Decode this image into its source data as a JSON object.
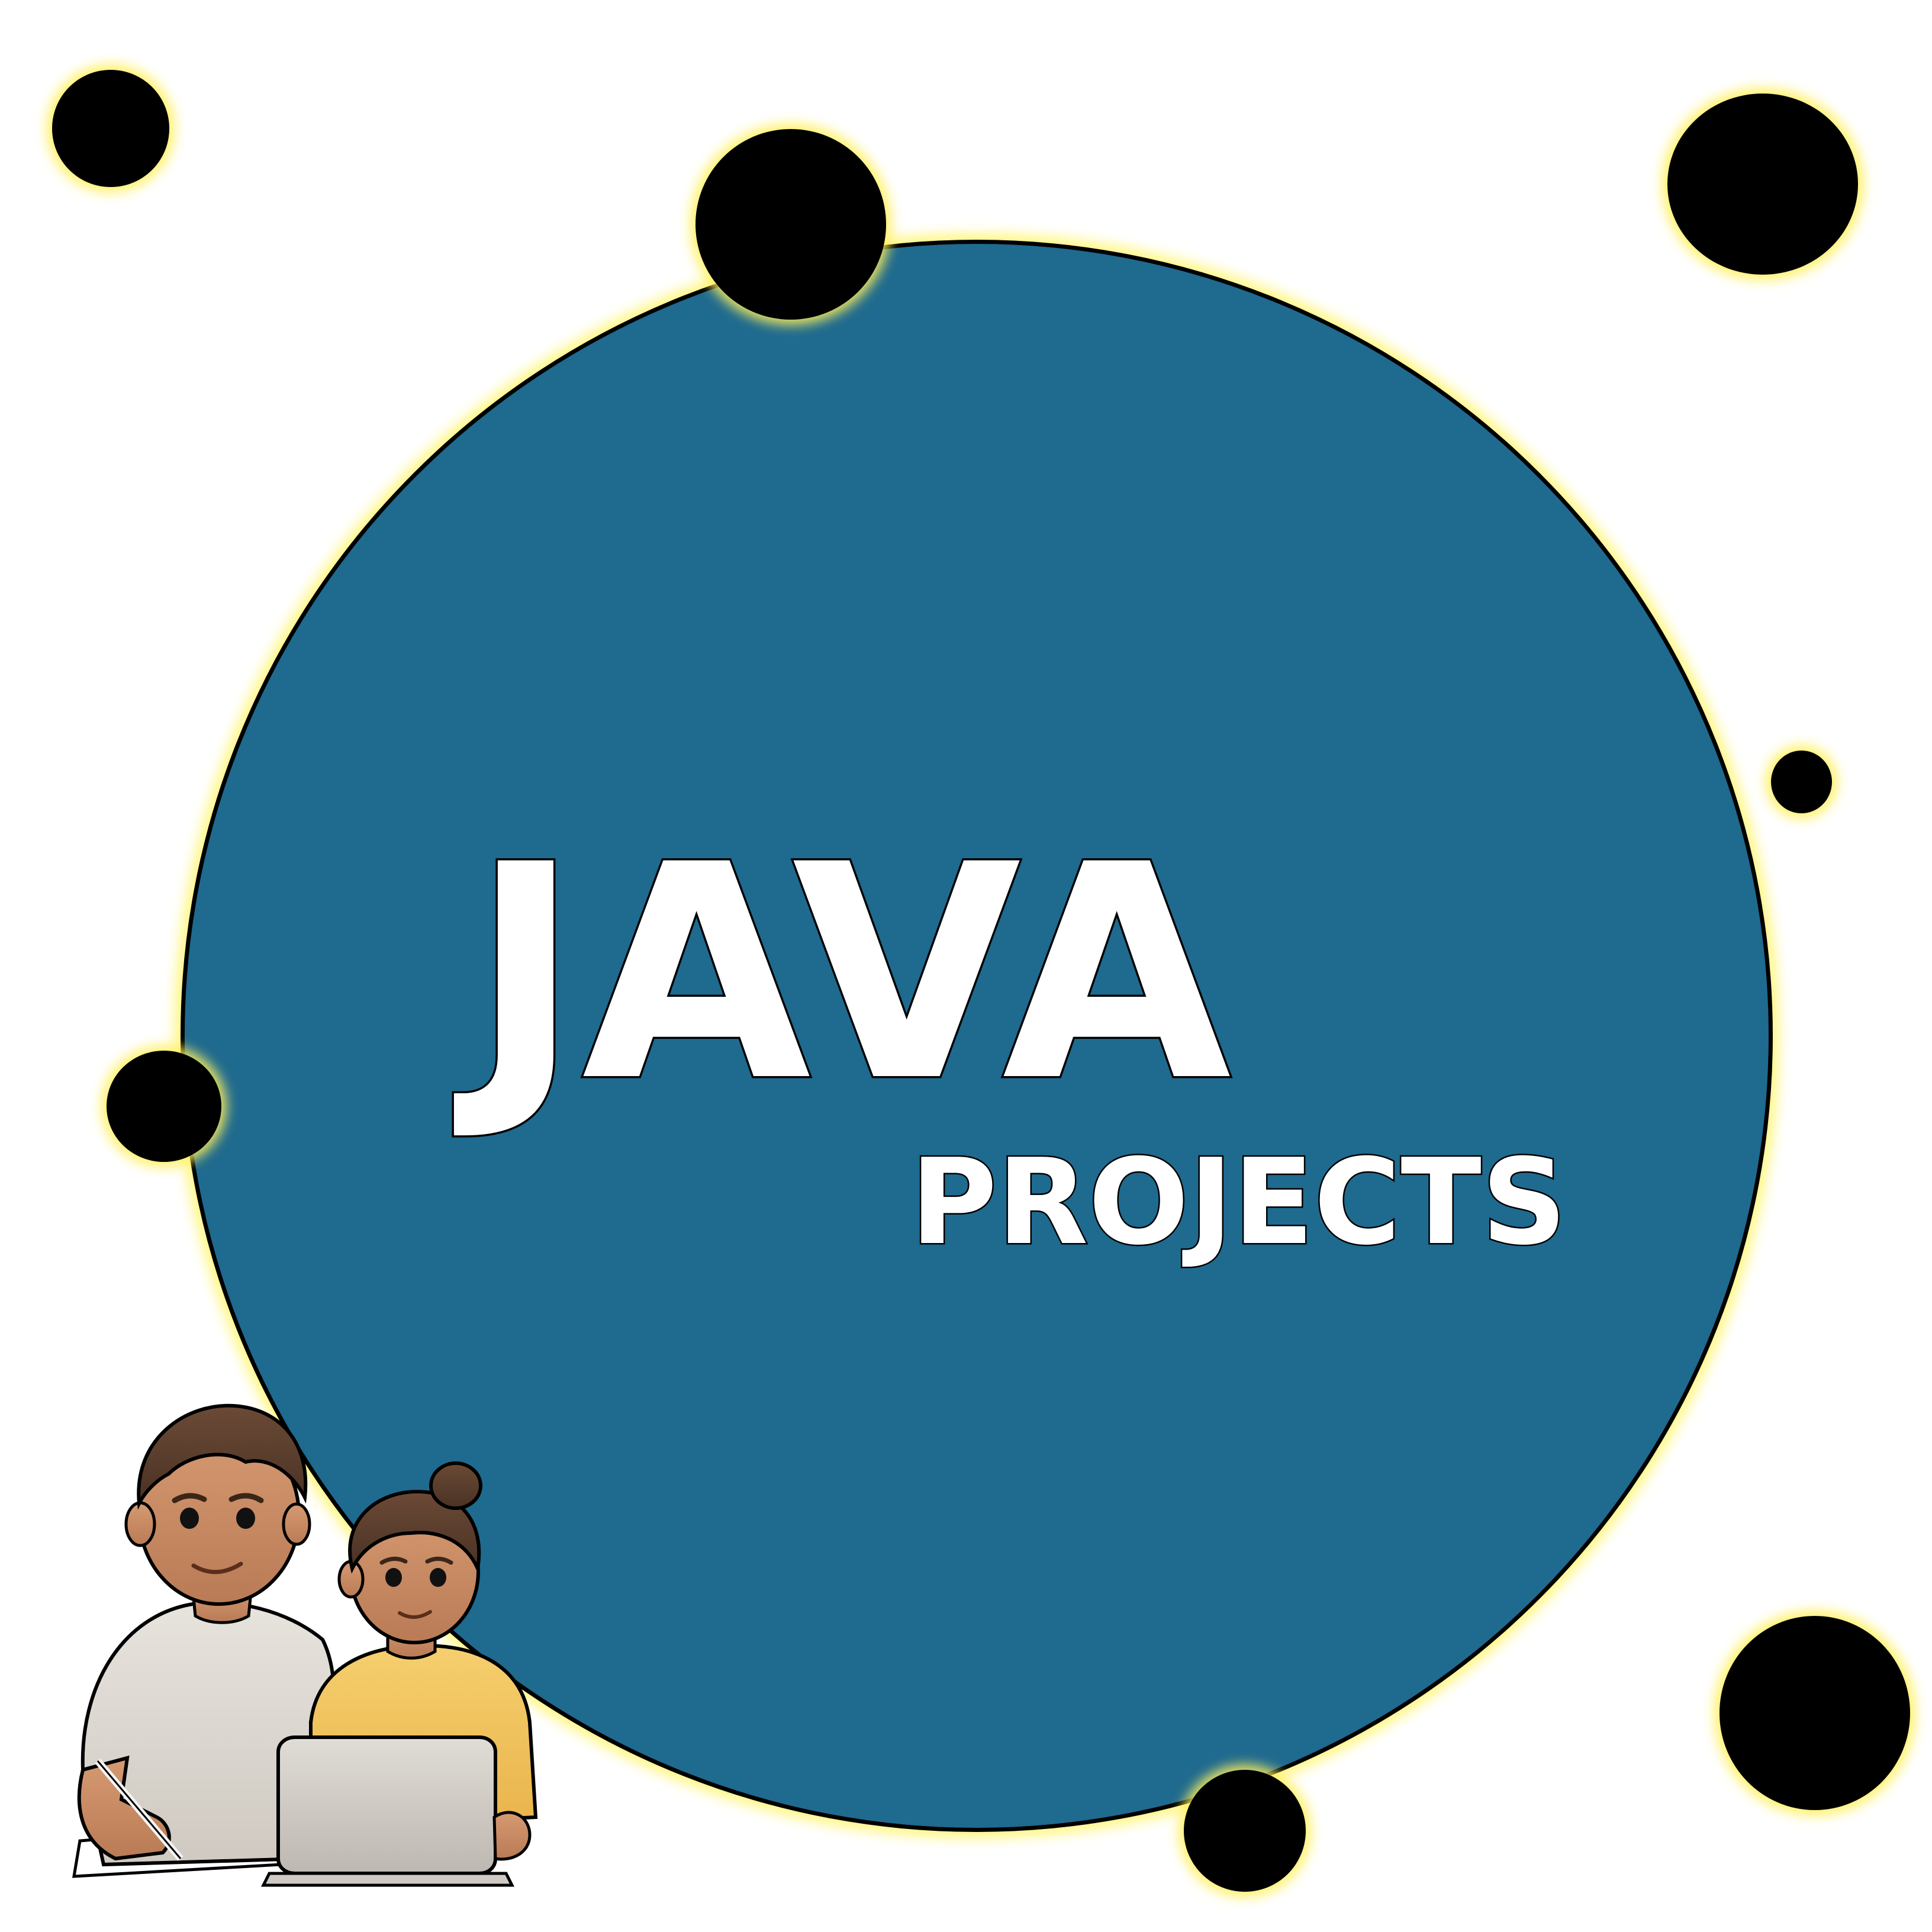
{
  "title": "JAVA",
  "subtitle": "PROJECTS",
  "colors": {
    "background": "#ffffff",
    "circle_fill": "#1f6a8f",
    "outline": "#000000",
    "glow": "#fff07a",
    "text": "#ffffff"
  },
  "illustration": {
    "icon": "two-people-with-laptop-icon"
  }
}
